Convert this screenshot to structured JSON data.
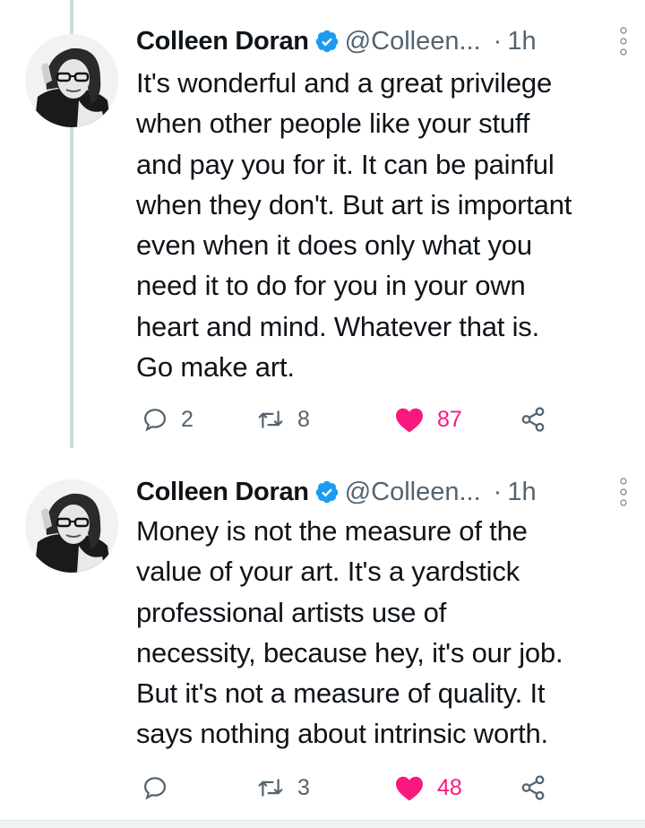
{
  "tweets": [
    {
      "author": "Colleen Doran",
      "handle": "@Colleen...",
      "separator": "·",
      "time": "1h",
      "text": "It's wonderful and a great privilege\nwhen other people like your stuff\nand pay you for it. It can be painful\nwhen they don't. But art is important\neven when it does only what you\nneed it to do for you in your own\nheart and mind. Whatever that is.\nGo make art.",
      "replies": "2",
      "retweets": "8",
      "likes": "87"
    },
    {
      "author": "Colleen Doran",
      "handle": "@Colleen...",
      "separator": "·",
      "time": "1h",
      "text": "Money is not the measure of the\nvalue of your art. It's a yardstick\nprofessional artists use of\nnecessity, because hey, it's our job.\nBut it's not a measure of quality. It\nsays nothing about intrinsic worth.",
      "replies": "",
      "retweets": "3",
      "likes": "48"
    }
  ],
  "icons": {
    "verified": "verified-badge-icon",
    "reply": "reply-icon",
    "retweet": "retweet-icon",
    "like": "heart-icon",
    "share": "share-icon",
    "more": "more-vertical-icon"
  },
  "colors": {
    "verified": "#1d9bf0",
    "like": "#f91880",
    "muted": "#536471",
    "thread_line": "#cfd9de"
  }
}
